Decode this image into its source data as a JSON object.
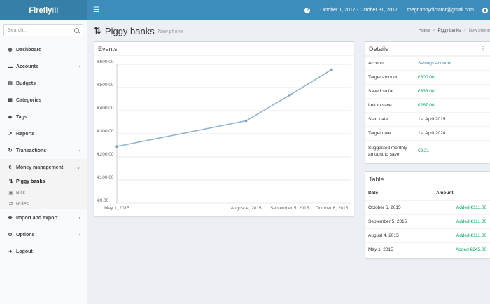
{
  "brand": {
    "bold": "Firefly",
    "light": "III"
  },
  "topbar": {
    "daterange": "October 1, 2017 - October 31, 2017",
    "user_email": "thegrumpydictator@gmail.com"
  },
  "sidebar": {
    "search_placeholder": "Search...",
    "items": [
      {
        "label": "Dashboard",
        "icon": "dashboard-icon"
      },
      {
        "label": "Accounts",
        "icon": "credit-card-icon"
      },
      {
        "label": "Budgets",
        "icon": "tasks-icon"
      },
      {
        "label": "Categories",
        "icon": "bar-chart-icon"
      },
      {
        "label": "Tags",
        "icon": "tags-icon"
      },
      {
        "label": "Reports",
        "icon": "line-chart-icon"
      },
      {
        "label": "Transactions",
        "icon": "repeat-icon"
      },
      {
        "label": "Money management",
        "icon": "euro-icon"
      }
    ],
    "sub_items": [
      {
        "label": "Piggy banks",
        "icon": "sort-amount-icon"
      },
      {
        "label": "Bills",
        "icon": "calendar-icon"
      },
      {
        "label": "Rules",
        "icon": "random-icon"
      }
    ],
    "bottom_items": [
      {
        "label": "Import and export",
        "icon": "arrows-icon"
      },
      {
        "label": "Options",
        "icon": "cogs-icon"
      },
      {
        "label": "Logout",
        "icon": "sign-out-icon"
      }
    ]
  },
  "header": {
    "title": "Piggy banks",
    "subtitle": "New phone",
    "breadcrumb": [
      "Home",
      "Piggy banks",
      "New phone"
    ]
  },
  "events": {
    "title": "Events"
  },
  "details": {
    "title": "Details",
    "rows": [
      {
        "label": "Account",
        "value": "Savings Account",
        "style": "link"
      },
      {
        "label": "Target amount",
        "value": "€600.00",
        "style": "green"
      },
      {
        "label": "Saved so far",
        "value": "€333.00",
        "style": "green"
      },
      {
        "label": "Left to save",
        "value": "€267.00",
        "style": "green"
      },
      {
        "label": "Start date",
        "value": "1st April 2015",
        "style": "plain"
      },
      {
        "label": "Target date",
        "value": "1st April 2020",
        "style": "plain"
      },
      {
        "label": "Suggested monthly amount to save",
        "value": "€9.21",
        "style": "green"
      }
    ]
  },
  "table": {
    "title": "Table",
    "headers": [
      "Date",
      "Amount"
    ],
    "rows": [
      {
        "date": "October 6, 2015",
        "amount": "Added €111.00"
      },
      {
        "date": "September 5, 2015",
        "amount": "Added €111.00"
      },
      {
        "date": "August 4, 2015",
        "amount": "Added €111.00"
      },
      {
        "date": "May 1, 2015",
        "amount": "Added €245.00"
      }
    ]
  },
  "colors": {
    "line": "#91b4cf",
    "point": "#6a9fc8",
    "accent": "#3c8dbc",
    "green": "#00a65a"
  },
  "chart_data": {
    "type": "line",
    "title": "",
    "x": [
      "May 1, 2015",
      "August 4, 2015",
      "September 5, 2015",
      "October 6, 2015"
    ],
    "series": [
      {
        "values": [
          245,
          356,
          467,
          578
        ]
      }
    ],
    "ylim": [
      0,
      600
    ],
    "yticks": [
      "€0.00",
      "€100.00",
      "€200.00",
      "€300.00",
      "€400.00",
      "€500.00",
      "€600.00"
    ],
    "xticks": [
      "May 1, 2015",
      "August 4, 2015",
      "September 5, 2015",
      "October 6, 2015"
    ],
    "grid": true
  }
}
